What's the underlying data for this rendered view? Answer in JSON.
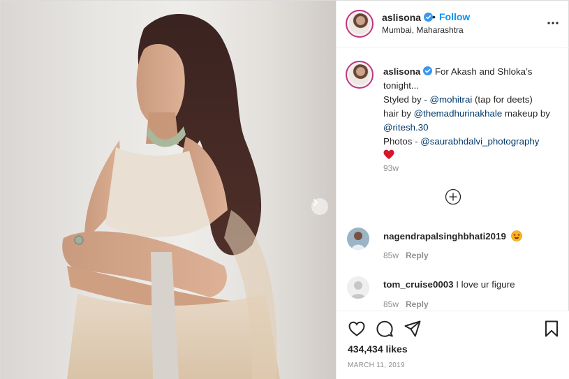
{
  "post": {
    "username": "aslisona",
    "separator": "•",
    "follow_label": "Follow",
    "location": "Mumbai, Maharashtra"
  },
  "caption": {
    "username": "aslisona",
    "line1": " For Akash and Shloka’s tonight...",
    "styled_prefix": "Styled by - ",
    "styled_mention": "@mohitrai",
    "styled_suffix": " (tap for deets)",
    "hair_prefix": "hair by ",
    "hair_mention": "@themadhurinakhale",
    "makeup_prefix": " makeup by ",
    "makeup_mention": "@ritesh.30",
    "photos_prefix": "Photos - ",
    "photos_mention": "@saurabhdalvi_photography",
    "emoji": "red-heart-emoji",
    "time": "93w"
  },
  "comments": [
    {
      "username": "nagendrapalsinghbhati2019",
      "text": "",
      "emoji": "star-struck-emoji",
      "time": "85w",
      "reply_label": "Reply"
    },
    {
      "username": "tom_cruise0003",
      "text": "I love ur figure",
      "time": "85w",
      "reply_label": "Reply"
    }
  ],
  "actions": {
    "icons": [
      "heart-icon",
      "comment-icon",
      "share-icon",
      "bookmark-icon"
    ],
    "likes": "434,434 likes",
    "date": "MARCH 11, 2019"
  },
  "colors": {
    "link": "#00376b",
    "follow": "#0095f6",
    "meta": "#8e8e8e",
    "border": "#dbdbdb"
  }
}
